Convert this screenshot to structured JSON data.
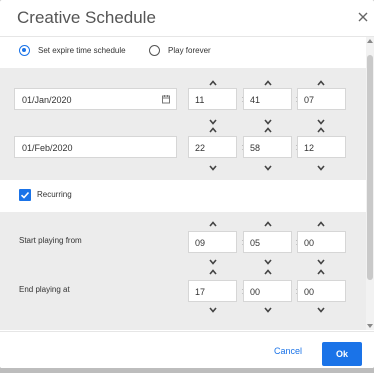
{
  "dialog": {
    "title": "Creative Schedule"
  },
  "schedule_mode": {
    "options": [
      {
        "label": "Set expire time schedule",
        "selected": true
      },
      {
        "label": "Play forever",
        "selected": false
      }
    ]
  },
  "start": {
    "date": "01/Jan/2020",
    "hour": "11",
    "minute": "41",
    "second": "07"
  },
  "end": {
    "date": "01/Feb/2020",
    "hour": "22",
    "minute": "58",
    "second": "12"
  },
  "recurring": {
    "label": "Recurring",
    "checked": true
  },
  "daily": {
    "start_label": "Start playing from",
    "start_hour": "09",
    "start_minute": "05",
    "start_second": "00",
    "end_label": "End playing at",
    "end_hour": "17",
    "end_minute": "00",
    "end_second": "00"
  },
  "separator": ":",
  "footer": {
    "cancel_label": "Cancel",
    "ok_label": "Ok"
  },
  "colors": {
    "accent": "#1a73e8",
    "panel": "#ececec"
  },
  "icons": {
    "close": "close-icon",
    "calendar": "calendar-icon",
    "increment": "chevron-up-icon",
    "decrement": "chevron-down-icon",
    "checkbox": "check-icon"
  }
}
